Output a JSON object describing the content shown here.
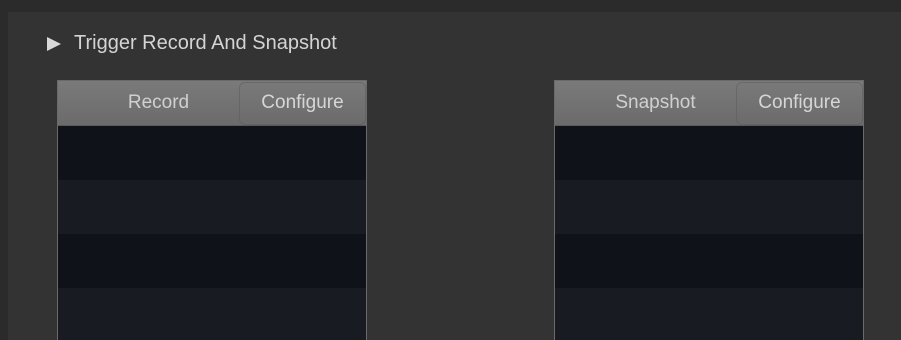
{
  "section": {
    "title": "Trigger Record And Snapshot",
    "expand_icon": "triangle-right-icon"
  },
  "record_grid": {
    "column_label": "Record",
    "configure_label": "Configure",
    "rows": [
      "",
      "",
      "",
      ""
    ]
  },
  "snapshot_grid": {
    "column_label": "Snapshot",
    "configure_label": "Configure",
    "rows": [
      "",
      "",
      "",
      ""
    ]
  },
  "colors": {
    "background": "#2b2b2b",
    "panel": "#333333",
    "header": "#737373",
    "row_dark": "#10121a",
    "row_light": "#181b22",
    "text": "#d4d4d4"
  }
}
